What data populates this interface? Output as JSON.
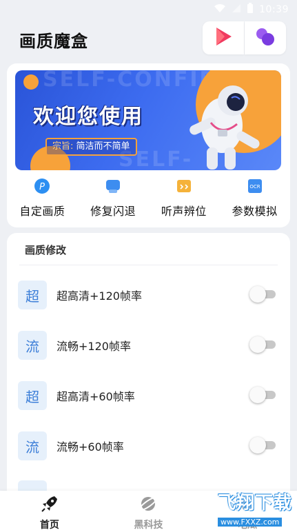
{
  "status_bar": {
    "time": "10:39"
  },
  "header": {
    "title": "画质魔盒"
  },
  "banner": {
    "title": "欢迎您使用",
    "slogan_label": "宗旨:",
    "slogan_text": "简洁而不简单",
    "watermark_1": "SELF-CONFID",
    "watermark_2": "SELF-CONFIDEN"
  },
  "quick_actions": [
    {
      "label": "自定画质",
      "icon": "p-circle-icon",
      "color": "#2d8ff2"
    },
    {
      "label": "修复闪退",
      "icon": "chat-icon",
      "color": "#3d8df0"
    },
    {
      "label": "听声辨位",
      "icon": "box-icon",
      "color": "#f5b23a"
    },
    {
      "label": "参数模拟",
      "icon": "oc-icon",
      "color": "#3d8df0",
      "icon_text": "OCR"
    }
  ],
  "quality_section": {
    "title": "画质修改",
    "options": [
      {
        "badge": "超",
        "label": "超高清+120帧率",
        "enabled": false
      },
      {
        "badge": "流",
        "label": "流畅+120帧率",
        "enabled": false
      },
      {
        "badge": "超",
        "label": "超高清+60帧率",
        "enabled": false
      },
      {
        "badge": "流",
        "label": "流畅+60帧率",
        "enabled": false
      }
    ]
  },
  "bottom_nav": [
    {
      "label": "首页",
      "icon": "rocket-icon",
      "active": true
    },
    {
      "label": "黑科技",
      "icon": "planet-icon",
      "active": false
    },
    {
      "label": "吃瓜",
      "icon": "melon-icon",
      "active": false
    }
  ],
  "site_watermark": {
    "title": "飞翔下载",
    "url": "www.FXXZ.com"
  },
  "colors": {
    "accent": "#3d7fd8",
    "banner_blue": "#2a54d8",
    "banner_orange": "#f7a23a",
    "background": "#eef0f4"
  }
}
